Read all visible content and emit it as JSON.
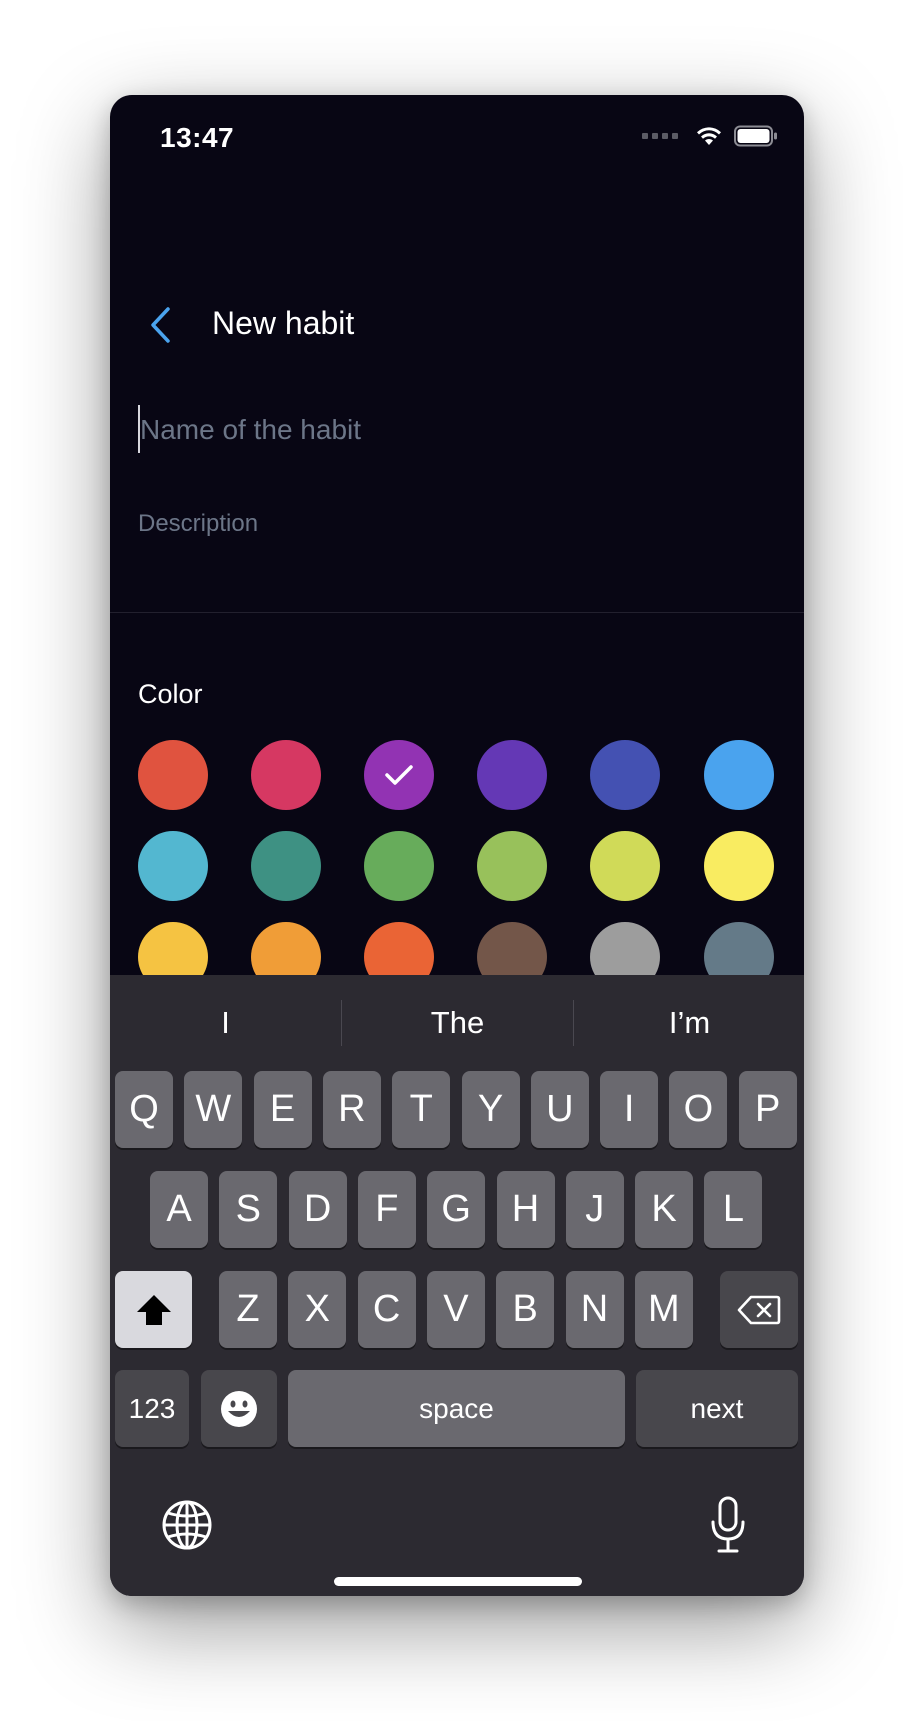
{
  "status_bar": {
    "time": "13:47"
  },
  "header": {
    "title": "New habit"
  },
  "form": {
    "name_placeholder": "Name of the habit",
    "name_value": "",
    "description_placeholder": "Description",
    "description_value": ""
  },
  "color_section": {
    "label": "Color",
    "selected_index": 2,
    "swatches": [
      "#E0533F",
      "#D63862",
      "#9233B3",
      "#6438B5",
      "#4451B2",
      "#4AA3EE",
      "#53B7D0",
      "#3E9183",
      "#67AC5B",
      "#98C15B",
      "#D0DA58",
      "#F9EC61",
      "#F5C342",
      "#F09D37",
      "#EA6435",
      "#735649",
      "#9D9D9D",
      "#647A88"
    ]
  },
  "keyboard": {
    "suggestions": [
      "I",
      "The",
      "I’m"
    ],
    "row1": [
      "Q",
      "W",
      "E",
      "R",
      "T",
      "Y",
      "U",
      "I",
      "O",
      "P"
    ],
    "row2": [
      "A",
      "S",
      "D",
      "F",
      "G",
      "H",
      "J",
      "K",
      "L"
    ],
    "row3": [
      "Z",
      "X",
      "C",
      "V",
      "B",
      "N",
      "M"
    ],
    "numbers_label": "123",
    "space_label": "space",
    "next_label": "next"
  }
}
